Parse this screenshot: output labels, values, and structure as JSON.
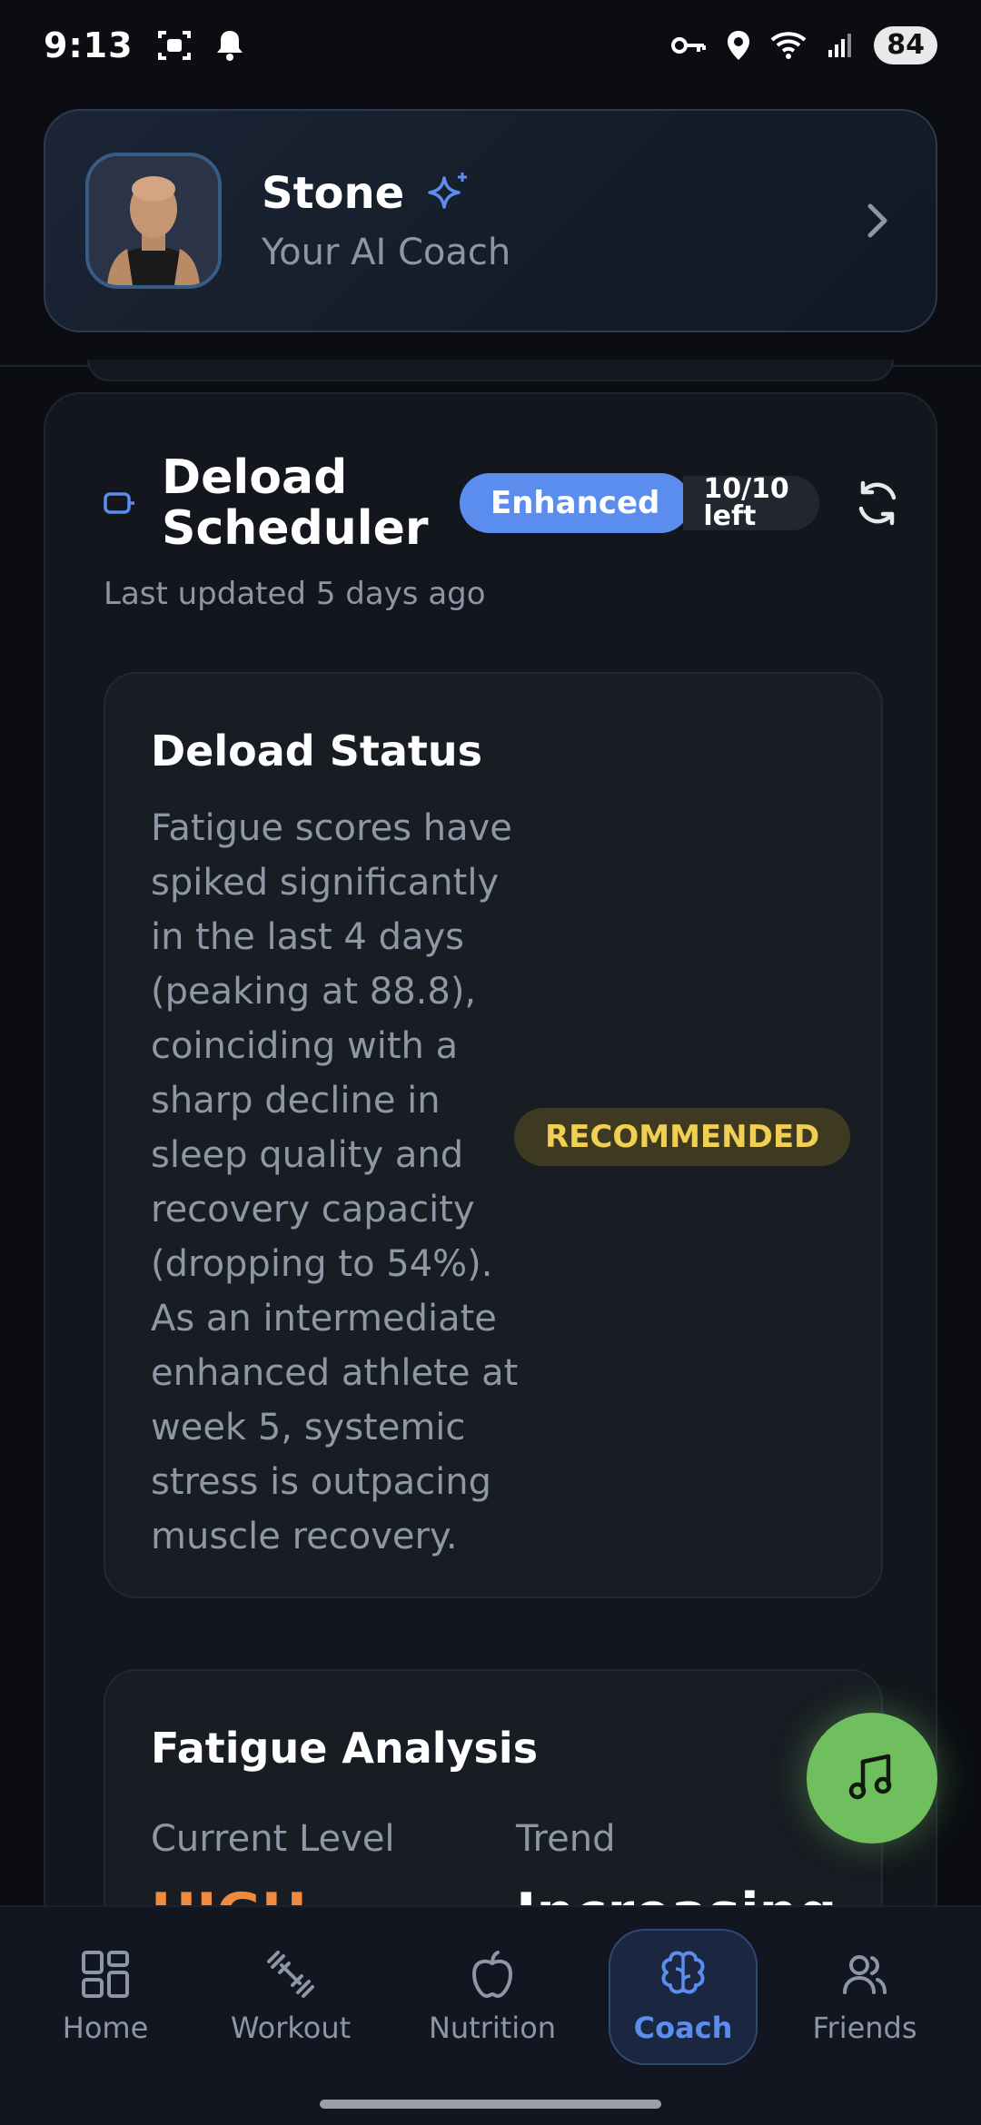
{
  "status_bar": {
    "time": "9:13",
    "battery": "84"
  },
  "coach": {
    "name": "Stone",
    "subtitle": "Your AI Coach"
  },
  "scheduler": {
    "title": "Deload Scheduler",
    "badge": "Enhanced",
    "uses_left": "10/10 left",
    "last_updated": "Last updated 5 days ago"
  },
  "deload_status": {
    "title": "Deload Status",
    "text": "Fatigue scores have spiked significantly in the last 4 days (peaking at 88.8), coinciding with a sharp decline in sleep quality and recovery capacity (dropping to 54%). As an intermediate enhanced athlete at week 5, systemic stress is outpacing muscle recovery.",
    "badge": "RECOMMENDED"
  },
  "fatigue": {
    "title": "Fatigue Analysis",
    "current_label": "Current Level",
    "current_value": "HIGH",
    "trend_label": "Trend",
    "trend_value": "Increasing"
  },
  "nav": {
    "items": [
      {
        "label": "Home",
        "icon": "grid-icon"
      },
      {
        "label": "Workout",
        "icon": "dumbbell-icon"
      },
      {
        "label": "Nutrition",
        "icon": "apple-icon"
      },
      {
        "label": "Coach",
        "icon": "brain-icon"
      },
      {
        "label": "Friends",
        "icon": "users-icon"
      }
    ],
    "active": "Coach"
  },
  "colors": {
    "accent": "#5b8def",
    "recommended": "#f1cf52",
    "fab": "#6fbf5f",
    "high": "#f08a3c"
  }
}
